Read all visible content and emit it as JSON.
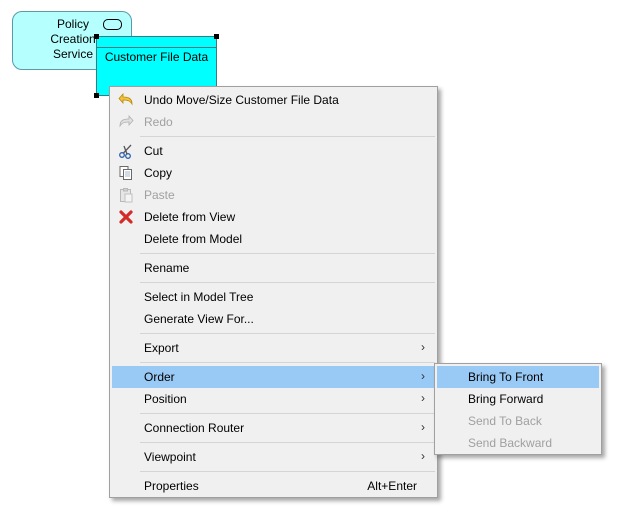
{
  "diagram": {
    "service_label": "Policy\nCreation\nService",
    "data_object_label": "Customer File Data"
  },
  "menu": {
    "undo": "Undo Move/Size Customer File Data",
    "redo": "Redo",
    "cut": "Cut",
    "copy": "Copy",
    "paste": "Paste",
    "delete_view": "Delete from View",
    "delete_model": "Delete from Model",
    "rename": "Rename",
    "select_tree": "Select in Model Tree",
    "generate_view": "Generate View For...",
    "export": "Export",
    "order": "Order",
    "position": "Position",
    "connection_router": "Connection Router",
    "viewpoint": "Viewpoint",
    "properties": "Properties",
    "properties_shortcut": "Alt+Enter",
    "submenu_arrow": "›"
  },
  "submenu": {
    "bring_to_front": "Bring To Front",
    "bring_forward": "Bring Forward",
    "send_to_back": "Send To Back",
    "send_backward": "Send Backward"
  },
  "icons": {
    "undo": "undo-icon",
    "redo": "redo-icon",
    "cut": "scissors-icon",
    "copy": "copy-icon",
    "paste": "paste-icon",
    "delete": "red-x-icon"
  }
}
